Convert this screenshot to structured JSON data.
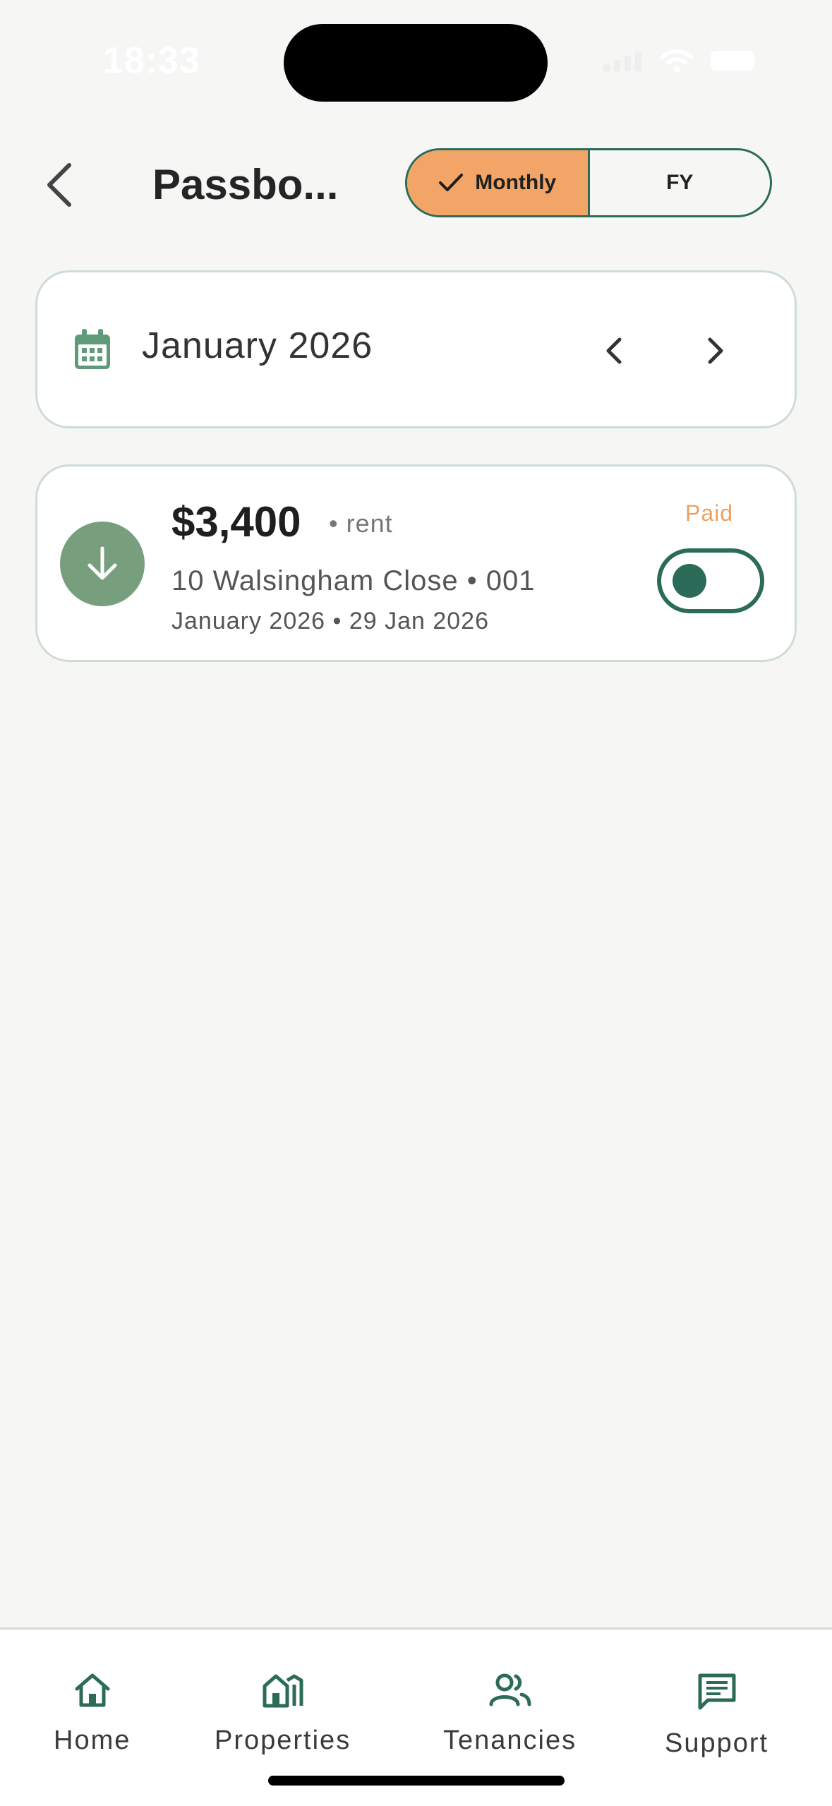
{
  "status_bar": {
    "time": "18:33"
  },
  "header": {
    "title": "Passbo...",
    "segments": [
      {
        "label": "Monthly",
        "active": true
      },
      {
        "label": "FY",
        "active": false
      }
    ]
  },
  "month_picker": {
    "label": "January 2026"
  },
  "payments": [
    {
      "amount": "$3,400",
      "type": "• rent",
      "address": "10 Walsingham Close • 001",
      "period": "January 2026 • 29 Jan 2026",
      "status_label": "Paid",
      "toggle_on": false
    }
  ],
  "tabbar": {
    "items": [
      {
        "label": "Home",
        "icon": "home-icon"
      },
      {
        "label": "Properties",
        "icon": "properties-icon"
      },
      {
        "label": "Tenancies",
        "icon": "people-icon"
      },
      {
        "label": "Support",
        "icon": "chat-icon"
      }
    ]
  },
  "colors": {
    "accent": "#2c6b58",
    "orange": "#f2a566",
    "paid": "#f0a05e",
    "incoming": "#789f7d",
    "background": "#f6f6f4"
  }
}
